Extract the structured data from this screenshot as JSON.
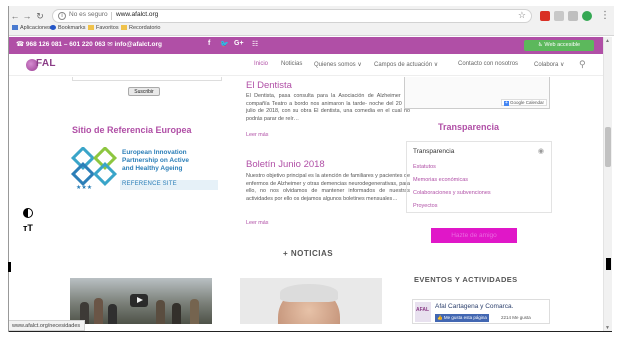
{
  "browser": {
    "address": {
      "security_label": "No es seguro",
      "url": "www.afalct.org"
    },
    "bookmarks": [
      {
        "label": "Aplicaciones",
        "icon": "apps-grid-icon"
      },
      {
        "label": "Bookmarks",
        "icon": "star-icon"
      },
      {
        "label": "Favoritos",
        "icon": "folder-icon"
      },
      {
        "label": "Recordatorio",
        "icon": "folder-icon"
      }
    ],
    "status_url": "www.afalct.org/necesidades"
  },
  "topbar": {
    "contact": "☎ 968 126 081 – 601 220 063  ✉ info@afalct.org",
    "social": [
      "f",
      "🐦",
      "G+",
      "☷"
    ],
    "accessibility_button": "Web accesible",
    "color": "#b04fa6"
  },
  "nav": {
    "logo": "FAL",
    "items": [
      "Inicio",
      "Noticias",
      "Quienes somos ∨",
      "Campos de actuación ∨",
      "Contacto con nosotros",
      "Colabora ∨"
    ],
    "active_item": "Inicio"
  },
  "left": {
    "subscribe_button": "Suscribir",
    "reference_title": "Sitio de Referencia Europea",
    "eip": {
      "lines": [
        "European Innovation",
        "Partnership on Active",
        "and Healthy Ageing"
      ],
      "subtitle": "REFERENCE SITE"
    }
  },
  "accessibility": {
    "contrast_icon": "contrast-icon",
    "textsize_label": "тT"
  },
  "posts": [
    {
      "title": "El Dentista",
      "body": "El Dentista, pasa consulta para la Asociación de Alzheimer La compañía Teatro a bordo nos animaron la tarde- noche del 20 de julio de 2018, con su obra El dentista, una comedia en el cual no podrás parar de reír…",
      "more": "Leer más"
    },
    {
      "title": "Boletín Junio 2018",
      "body": "Nuestro objetivo principal es la atención de familiares y pacientes de enfermos de Alzheimer y otras demencias neurodegenerativas, para ello, no nos olvidamos de mantener informados de nuestras actividades por ello os dejamos algunos boletines mensuales…",
      "more": "Leer más"
    }
  ],
  "noticias_heading": "+ NOTICIAS",
  "right": {
    "calendar_badge": "Google Calendar",
    "transparency_title": "Transparencia",
    "transparency_box": {
      "heading": "Transparencia",
      "links": [
        "Estatutos",
        "Memorias económicas",
        "Colaboraciones y subvenciones",
        "Proyectos"
      ]
    },
    "hazte_button": "Hazte de amigo",
    "events_heading": "EVENTOS Y ACTIVIDADES",
    "facebook": {
      "logo": "AFAL",
      "page_name": "Afal Cartagena y Comarca.",
      "like_label": "Me gusta esta página",
      "likes": "2214 Me gusta"
    }
  }
}
